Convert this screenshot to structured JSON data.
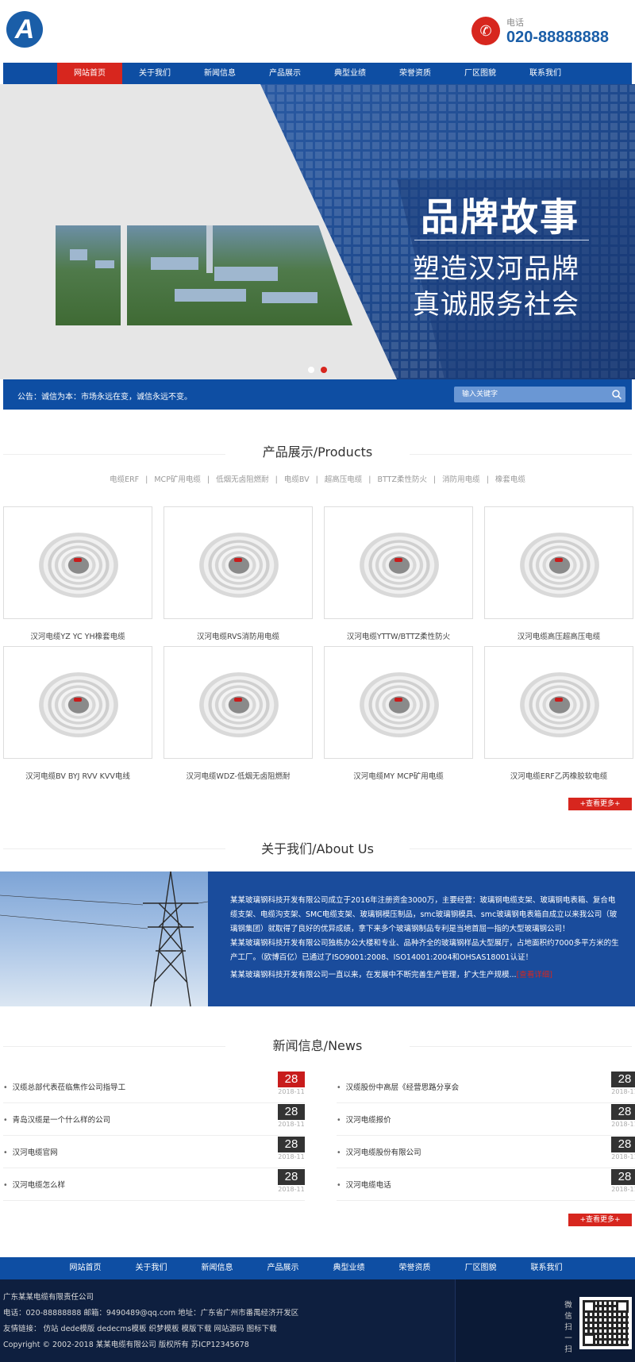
{
  "header": {
    "logo_letter": "A",
    "phone_label": "电话",
    "phone_number": "020-88888888"
  },
  "nav": {
    "items": [
      "网站首页",
      "关于我们",
      "新闻信息",
      "产品展示",
      "典型业绩",
      "荣誉资质",
      "厂区图貌",
      "联系我们"
    ],
    "active_index": 0
  },
  "banner": {
    "title": "品牌故事",
    "line1": "塑造汉河品牌",
    "line2": "真诚服务社会",
    "slide_count": 2,
    "active_slide": 1
  },
  "notice": {
    "text": "公告：诚信为本：市场永远在变，诚信永远不变。",
    "search_placeholder": "输入关键字"
  },
  "products": {
    "title": "产品展示/Products",
    "categories": [
      "电缆ERF",
      "MCP矿用电缆",
      "低烟无卤阻燃耐",
      "电缆BV",
      "超高压电缆",
      "BTTZ柔性防火",
      "消防用电缆",
      "橡套电缆"
    ],
    "items": [
      "汉河电缆YZ YC YH橡套电缆",
      "汉河电缆RVS消防用电缆",
      "汉河电缆YTTW/BTTZ柔性防火",
      "汉河电缆高压超高压电缆",
      "汉河电缆BV BYJ RVV KVV电线",
      "汉河电缆WDZ-低烟无卤阻燃耐",
      "汉河电缆MY MCP矿用电缆",
      "汉河电缆ERF乙丙橡胶软电缆"
    ],
    "more_label": "+查看更多+"
  },
  "about": {
    "title": "关于我们/About Us",
    "para1": "某某玻璃钢科技开发有限公司成立于2016年注册资金3000万，主要经营：玻璃钢电缆支架、玻璃钢电表箱、复合电缆支架、电缆沟支架、SMC电缆支架、玻璃钢模压制品，smc玻璃钢模具、smc玻璃钢电表箱自成立以来我公司（玻璃钢集团）就取得了良好的优异成绩，拿下来多个玻璃钢制品专利是当地首屈一指的大型玻璃钢公司！",
    "para2": "某某玻璃钢科技开发有限公司独栋办公大楼和专业、品种齐全的玻璃钢样品大型展厅，占地面积约7000多平方米的生产工厂。（欧博百亿）已通过了ISO9001:2008、ISO14001:2004和OHSAS18001认证！",
    "para3": " 某某玻璃钢科技开发有限公司一直以来，在发展中不断完善生产管理，扩大生产规模...",
    "more_link": "[查看详细]"
  },
  "news": {
    "title": "新闻信息/News",
    "left": [
      {
        "title": "汉缆总部代表莅临焦作公司指导工",
        "day": "28",
        "ym": "2018-11",
        "highlight": true
      },
      {
        "title": "青岛汉缆是一个什么样的公司",
        "day": "28",
        "ym": "2018-11",
        "highlight": false
      },
      {
        "title": "汉河电缆官网",
        "day": "28",
        "ym": "2018-11",
        "highlight": false
      },
      {
        "title": "汉河电缆怎么样",
        "day": "28",
        "ym": "2018-11",
        "highlight": false
      }
    ],
    "right": [
      {
        "title": "汉缆股份中高层《经营思路分享会",
        "day": "28",
        "ym": "2018-11",
        "highlight": false
      },
      {
        "title": "汉河电缆报价",
        "day": "28",
        "ym": "2018-11",
        "highlight": false
      },
      {
        "title": "汉河电缆股份有限公司",
        "day": "28",
        "ym": "2018-11",
        "highlight": false
      },
      {
        "title": "汉河电缆电话",
        "day": "28",
        "ym": "2018-11",
        "highlight": false
      }
    ],
    "more_label": "+查看更多+"
  },
  "footer": {
    "nav": [
      "网站首页",
      "关于我们",
      "新闻信息",
      "产品展示",
      "典型业绩",
      "荣誉资质",
      "厂区图貌",
      "联系我们"
    ],
    "company": "广东某某电缆有限责任公司",
    "contact": "电话：020-88888888   邮箱：9490489@qq.com   地址：广东省广州市番禺经济开发区",
    "links": "友情链接： 仿站 dede模版 dedecms模板 织梦模板 模版下载 网站源码 图标下载",
    "copyright": "Copyright © 2002-2018 某某电缆有限公司 版权所有    苏ICP12345678",
    "wechat_label": "微信扫一扫"
  },
  "colors": {
    "primary_blue": "#0e4ea3",
    "accent_red": "#d7261e",
    "footer_dark": "#0e1f3f"
  }
}
